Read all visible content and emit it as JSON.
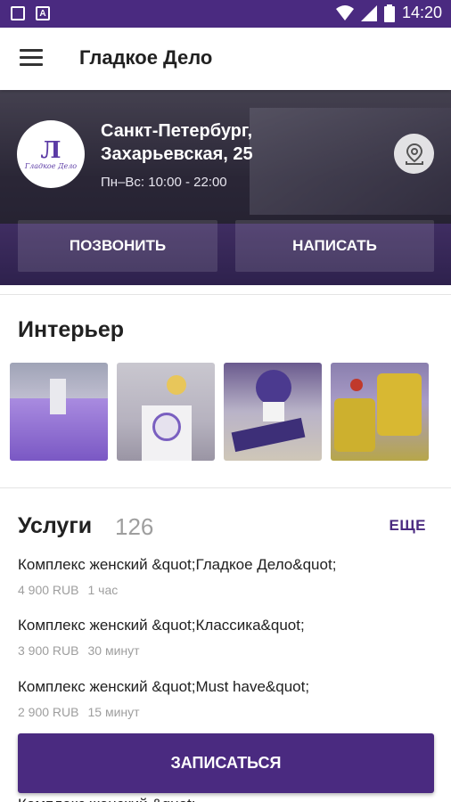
{
  "status_bar": {
    "time": "14:20",
    "icons": [
      "image-icon",
      "a-badge-icon",
      "wifi-icon",
      "signal-icon",
      "battery-icon"
    ]
  },
  "app_bar": {
    "title": "Гладкое Дело",
    "menu_icon": "menu-icon"
  },
  "hero": {
    "address": "Санкт-Петербург, Захарьевская, 25",
    "hours": "Пн–Вс: 10:00 - 22:00",
    "logo_mark": "Л",
    "logo_text": "Гладкое Дело",
    "map_icon": "map-pin-icon",
    "call_label": "ПОЗВОНИТЬ",
    "write_label": "НАПИСАТЬ"
  },
  "interior": {
    "title": "Интерьер",
    "photos": [
      "interior-photo-1",
      "interior-photo-2",
      "interior-photo-3",
      "interior-photo-4"
    ]
  },
  "services": {
    "title": "Услуги",
    "count": "126",
    "more_label": "ЕЩЕ",
    "items": [
      {
        "name": "Комплекс женский &quot;Гладкое Дело&quot;",
        "price": "4 900 RUB",
        "duration": "1 час"
      },
      {
        "name": "Комплекс женский &quot;Классика&quot;",
        "price": "3 900 RUB",
        "duration": "30 минут"
      },
      {
        "name": "Комплекс женский &quot;Must have&quot;",
        "price": "2 900 RUB",
        "duration": "15 минут"
      }
    ],
    "partial_next": "Комплекс женский &quot;"
  },
  "book_label": "ЗАПИСАТЬСЯ",
  "colors": {
    "primary": "#4a2a80",
    "muted_text": "#9e9e9e"
  }
}
